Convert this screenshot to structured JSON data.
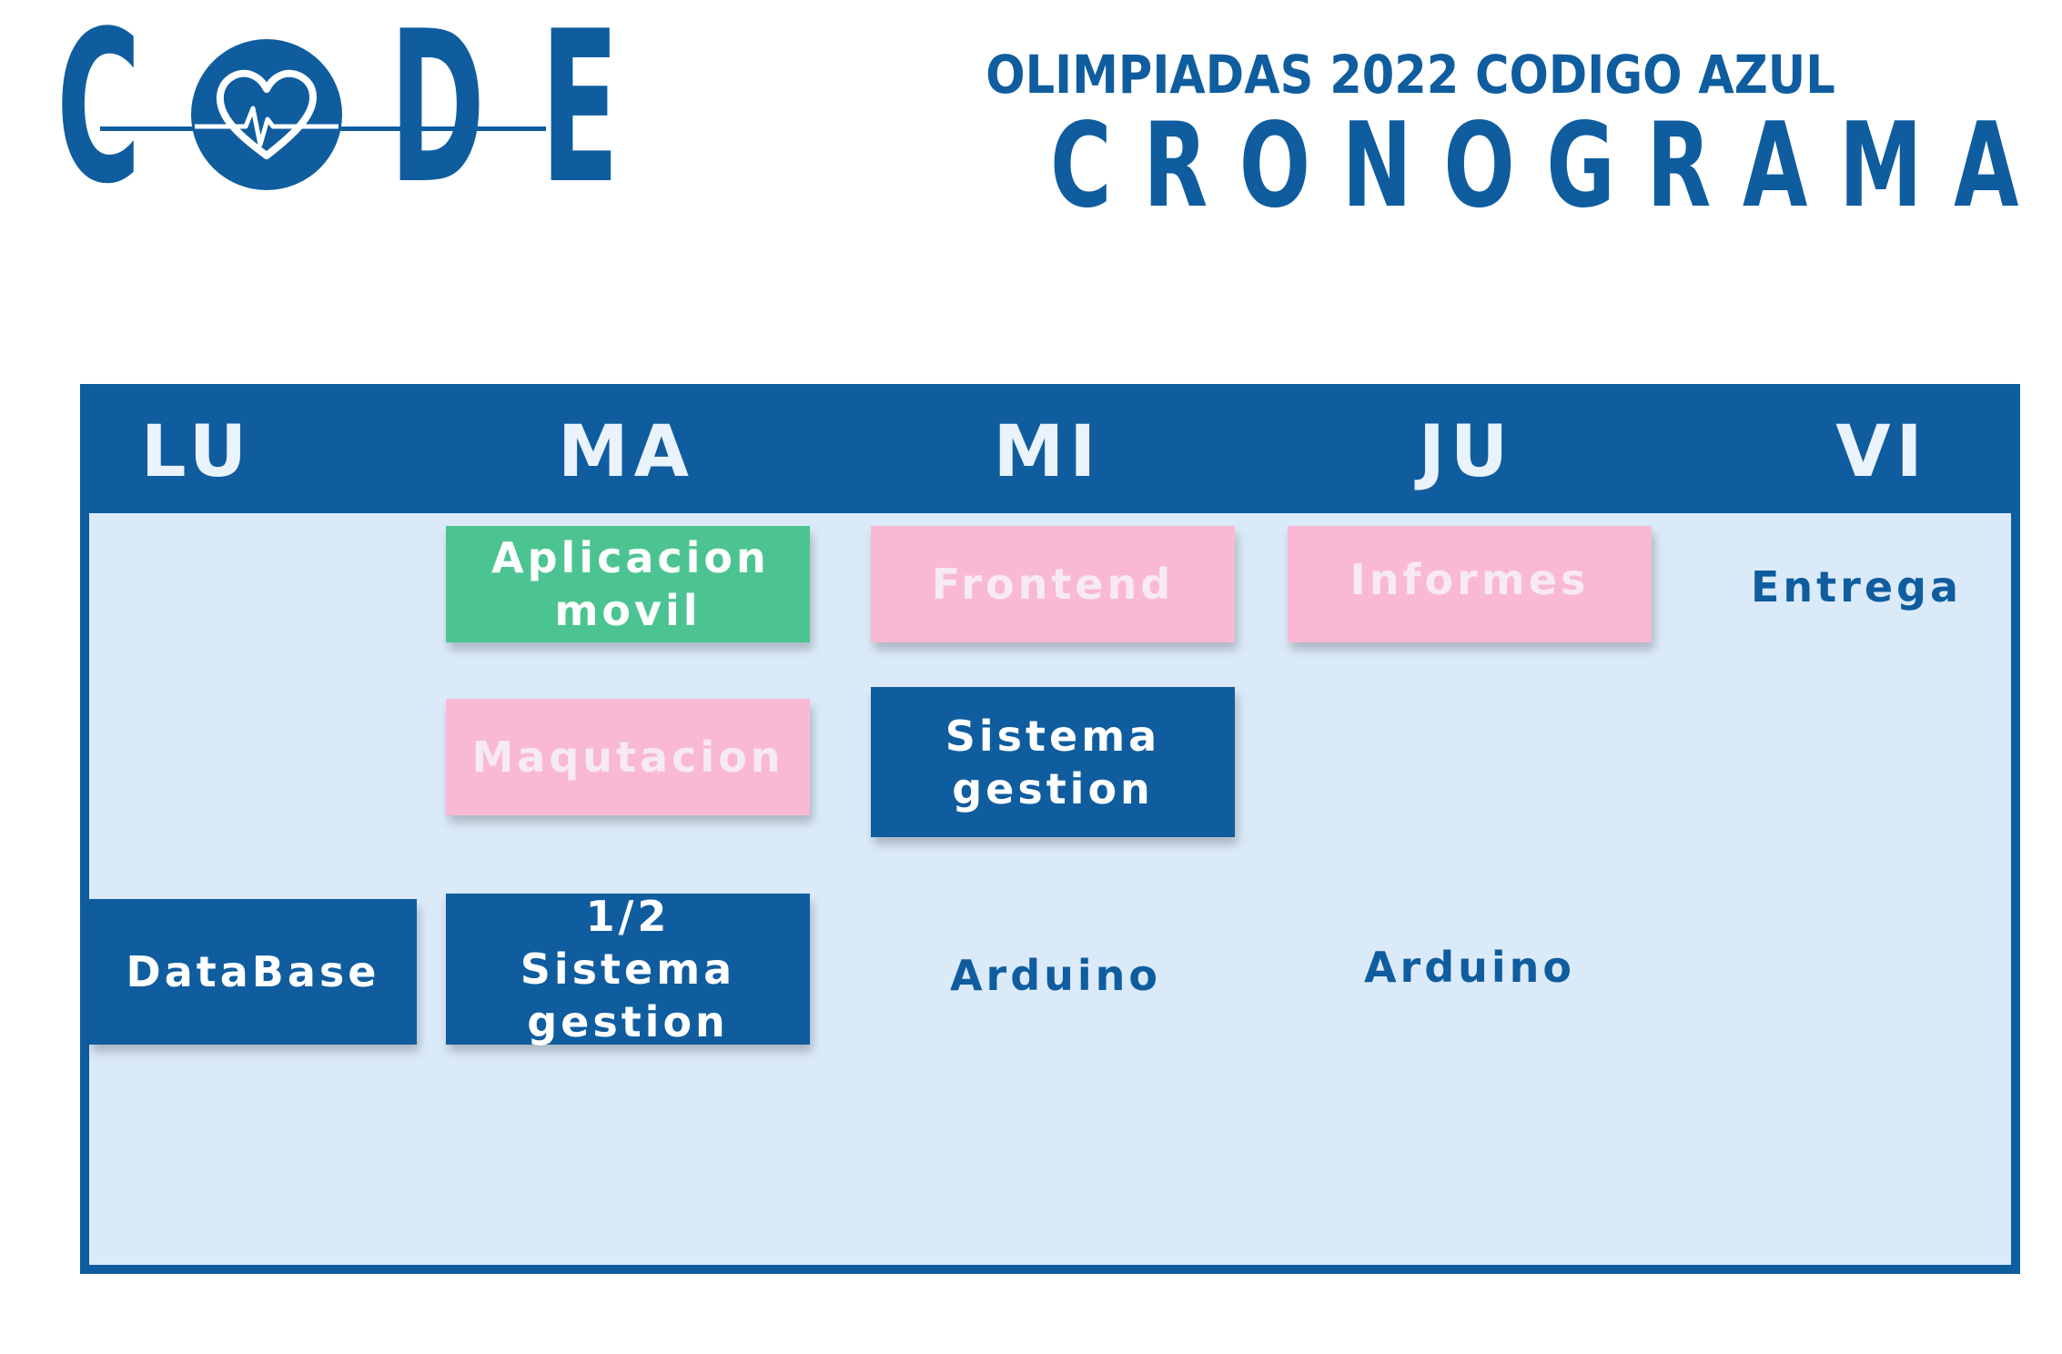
{
  "logo": {
    "letter_c": "C",
    "letter_d": "D",
    "letter_e": "E",
    "icon": "heart-pulse-icon"
  },
  "header": {
    "subtitle": "OLIMPIADAS 2022 CODIGO AZUL",
    "title": "CRONOGRAMA"
  },
  "days": [
    "LU",
    "MA",
    "MI",
    "JU",
    "VI"
  ],
  "tasks": {
    "aplicacion_movil": "Aplicacion movil",
    "frontend": "Frontend",
    "informes": "Informes",
    "entrega": "Entrega",
    "maqutacion": "Maqutacion",
    "sistema_gestion": "Sistema gestion",
    "database": "DataBase",
    "half_sistema_gestion": "1/2 Sistema gestion",
    "arduino_mi": "Arduino",
    "arduino_ju": "Arduino"
  },
  "colors": {
    "primary_blue": "#0f5d9f",
    "board_background": "#dbeaf9",
    "pink": "#f9b9d4",
    "green": "#4cc491"
  }
}
